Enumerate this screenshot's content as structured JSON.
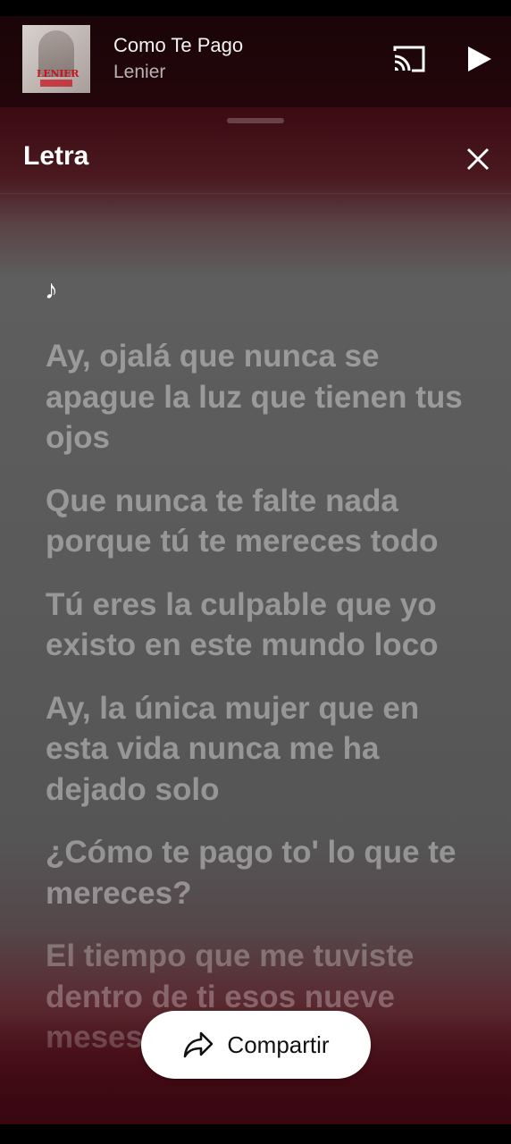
{
  "mini_player": {
    "album_art_text": "LENIER",
    "title": "Como Te Pago",
    "artist": "Lenier",
    "icons": {
      "cast": "cast-icon",
      "play": "play-icon"
    }
  },
  "lyrics_sheet": {
    "title": "Letra",
    "close_icon": "close-icon",
    "note_symbol": "♪",
    "lines": [
      "Ay, ojalá que nunca se apague la luz que tienen tus ojos",
      "Que nunca te falte nada porque tú te mereces todo",
      "Tú eres la culpable que yo existo en este mundo loco",
      "Ay, la única mujer que en esta vida nunca me ha dejado solo",
      "¿Cómo te pago to' lo que te mereces?",
      "El tiempo que me tuviste dentro de ti esos nueve meses"
    ],
    "share_button": {
      "label": "Compartir",
      "icon": "share-icon"
    }
  },
  "colors": {
    "sheet_top": "#3b0a12",
    "sheet_mid": "#5e5e5e",
    "sheet_bottom": "#3a0712",
    "brand_red": "#c8151d"
  }
}
